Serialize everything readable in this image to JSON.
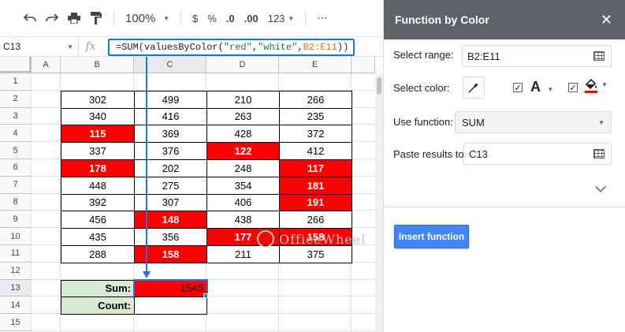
{
  "toolbar": {
    "zoom": "100%",
    "currency": "$",
    "percent": "%",
    "dec_decrease": ".0",
    "dec_increase": ".00",
    "format": "123",
    "more": "⋯"
  },
  "formula_bar": {
    "cell_ref": "C13",
    "fx": "fx",
    "formula_parts": [
      "=SUM(valuesByColor(",
      "\"red\"",
      ", ",
      "\"white\"",
      ", ",
      "B2:E11",
      "))"
    ]
  },
  "sheet": {
    "columns": [
      "A",
      "B",
      "C",
      "D",
      "E"
    ],
    "rows": [
      "1",
      "2",
      "3",
      "4",
      "5",
      "6",
      "7",
      "8",
      "9",
      "10",
      "11",
      "12",
      "13",
      "14",
      "15"
    ],
    "data": [
      [
        302,
        499,
        210,
        266
      ],
      [
        340,
        416,
        263,
        235
      ],
      [
        115,
        369,
        428,
        372
      ],
      [
        337,
        376,
        122,
        412
      ],
      [
        178,
        202,
        248,
        117
      ],
      [
        448,
        275,
        354,
        181
      ],
      [
        392,
        307,
        406,
        191
      ],
      [
        456,
        148,
        438,
        266
      ],
      [
        435,
        356,
        177,
        158
      ],
      [
        288,
        158,
        211,
        375
      ]
    ],
    "red_cells": [
      [
        2,
        0
      ],
      [
        3,
        2
      ],
      [
        4,
        0
      ],
      [
        4,
        3
      ],
      [
        5,
        3
      ],
      [
        6,
        3
      ],
      [
        7,
        1
      ],
      [
        8,
        2
      ],
      [
        8,
        3
      ],
      [
        9,
        1
      ]
    ],
    "sum_label": "Sum:",
    "count_label": "Count:",
    "sum_value": "1545",
    "count_value": "",
    "highlight_color": "#ff0000",
    "label_bg": "#d9ead3"
  },
  "watermark": {
    "text": "OfficeWheel"
  },
  "sidebar": {
    "title": "Function by Color",
    "close": "✕",
    "select_range_label": "Select range:",
    "select_range_value": "B2:E11",
    "select_color_label": "Select color:",
    "text_color_glyph": "A",
    "use_function_label": "Use function:",
    "use_function_value": "SUM",
    "paste_results_label": "Paste results to:",
    "paste_results_value": "C13",
    "insert_button": "Insert function",
    "header_bg": "#5f6368",
    "button_color": "#4285f4"
  }
}
